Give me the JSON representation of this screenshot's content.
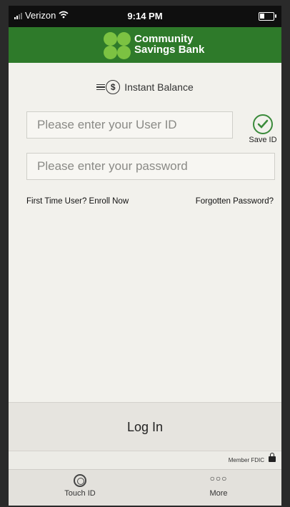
{
  "status_bar": {
    "carrier": "Verizon",
    "time": "9:14 PM"
  },
  "header": {
    "bank_name_line1": "Community",
    "bank_name_line2": "Savings Bank",
    "accent_color": "#2e7a2a",
    "logo_color": "#7cc242"
  },
  "instant_balance": {
    "label": "Instant Balance",
    "icon": "dollar-circle-icon"
  },
  "user_id_field": {
    "placeholder": "Please enter your User ID",
    "value": ""
  },
  "password_field": {
    "placeholder": "Please enter your password",
    "value": ""
  },
  "save_id": {
    "label": "Save ID",
    "checked": true
  },
  "links": {
    "enroll": "First Time User? Enroll Now",
    "forgot": "Forgotten Password?"
  },
  "login": {
    "label": "Log In"
  },
  "fdic": {
    "label": "Member FDIC"
  },
  "tabbar": {
    "touch_id": "Touch ID",
    "more": "More"
  }
}
